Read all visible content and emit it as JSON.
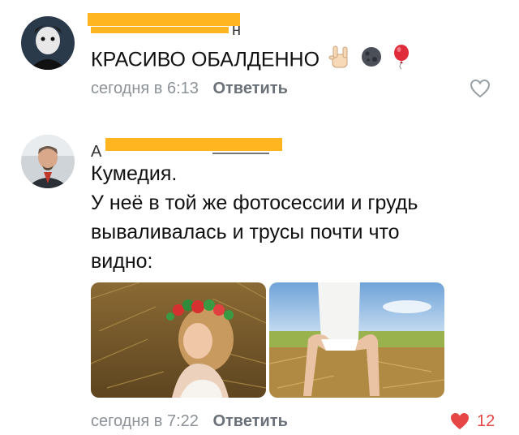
{
  "comments": [
    {
      "author_tail": "н",
      "text": "КРАСИВО ОБАЛДЕННО",
      "emojis": [
        "rock-hand-emoji",
        "dark-moon-emoji",
        "balloon-emoji"
      ],
      "time": "сегодня в 6:13",
      "reply": "Ответить",
      "liked": false
    },
    {
      "author_head": "А",
      "text_lines": [
        "Кумедия.",
        "У неё в той же фотосессии и грудь",
        "вываливалась и трусы почти что",
        "видно:"
      ],
      "photos": [
        "photo-wreath-haystack",
        "photo-haystack-sky"
      ],
      "time": "сегодня в 7:22",
      "reply": "Ответить",
      "liked": true,
      "likes": "12"
    }
  ],
  "colors": {
    "meta": "#8c9298",
    "like_active": "#e64646",
    "redaction": "#ffb51f"
  }
}
